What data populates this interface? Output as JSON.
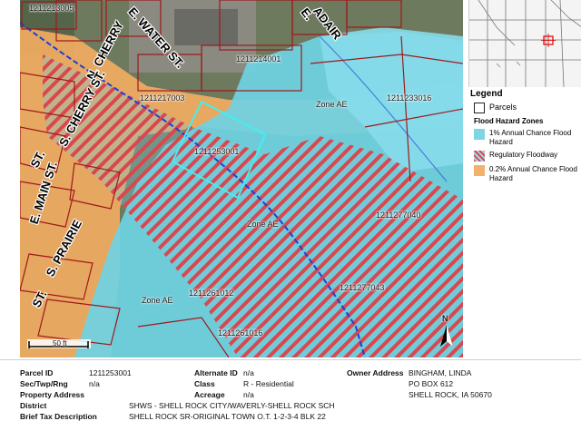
{
  "map": {
    "parcel_ids": [
      "1211213005",
      "1211214001",
      "1211217003",
      "1211233016",
      "1211253001",
      "1211277040",
      "1211261012",
      "1211277043",
      "1211261016"
    ],
    "zone_labels": [
      "Zone AE",
      "Zone AE",
      "Zone AE"
    ],
    "streets": {
      "n_cherry": "N. CHERRY",
      "e_water": "E. WATER ST.",
      "adair": "ADAIR",
      "adair_e": "E.",
      "s_cherry": "S. CHERRY ST.",
      "st1": "ST.",
      "e_main": "E. MAIN ST.",
      "s_prairie": "S. PRAIRIE",
      "st2": "ST."
    },
    "scale_label": "50 ft",
    "north_label": "N"
  },
  "legend": {
    "title": "Legend",
    "parcels_label": "Parcels",
    "flood_title": "Flood Hazard Zones",
    "items": [
      {
        "label": "1% Annual Chance Flood Hazard",
        "color": "#7fd5e6"
      },
      {
        "label": "Regulatory Floodway",
        "color": "#d94a52"
      },
      {
        "label": "0.2% Annual Chance Flood Hazard",
        "color": "#f4b16a"
      }
    ]
  },
  "details": {
    "parcel_id_label": "Parcel ID",
    "parcel_id": "1211253001",
    "sec_label": "Sec/Twp/Rng",
    "sec": "n/a",
    "prop_addr_label": "Property Address",
    "district_label": "District",
    "district": "SHWS - SHELL ROCK CITY/WAVERLY-SHELL ROCK SCH",
    "tax_label": "Brief Tax Description",
    "tax": "SHELL ROCK SR-ORIGINAL TOWN O.T. 1-2-3-4 BLK 22",
    "alt_label": "Alternate ID",
    "alt": "n/a",
    "class_label": "Class",
    "class": "R - Residential",
    "acreage_label": "Acreage",
    "acreage": "n/a",
    "owner_label": "Owner Address",
    "owner1": "BINGHAM, LINDA",
    "owner2": "PO BOX 612",
    "owner3": "SHELL ROCK, IA 50670"
  }
}
